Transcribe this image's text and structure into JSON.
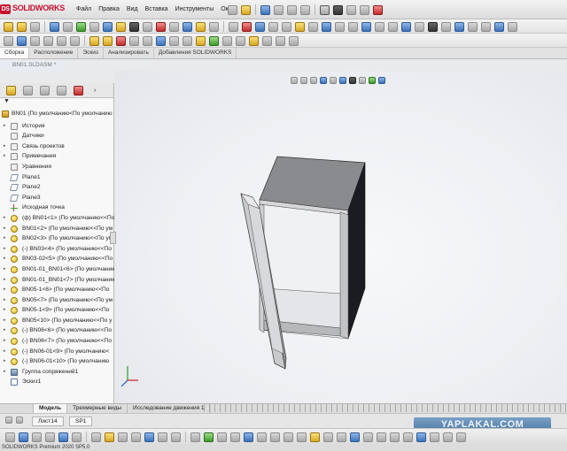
{
  "app": {
    "logo_text": "SOLIDWORKS",
    "logo_mark": "DS"
  },
  "menu": [
    "Файл",
    "Правка",
    "Вид",
    "Вставка",
    "Инструменты",
    "Окно"
  ],
  "command_tabs": [
    {
      "label": "Сборка",
      "active": true
    },
    {
      "label": "Расположение",
      "active": false
    },
    {
      "label": "Эскиз",
      "active": false
    },
    {
      "label": "Анализировать",
      "active": false
    },
    {
      "label": "Добавления SOLIDWORKS",
      "active": false
    }
  ],
  "document_tab": "BN01.SLDASM *",
  "feature_tree": {
    "filter_symbol": "▼",
    "root": "BN01  (По умолчанию<По умолчанию",
    "items": [
      {
        "label": "История",
        "icon": "folder-icon",
        "expandable": true
      },
      {
        "label": "Датчики",
        "icon": "folder-icon",
        "expandable": false
      },
      {
        "label": "Связь проектов",
        "icon": "folder-icon",
        "expandable": true
      },
      {
        "label": "Примечания",
        "icon": "folder-icon",
        "expandable": true
      },
      {
        "label": "Уравнения",
        "icon": "folder-icon",
        "expandable": false
      },
      {
        "label": "Plane1",
        "icon": "plane-icon",
        "expandable": false
      },
      {
        "label": "Plane2",
        "icon": "plane-icon",
        "expandable": false
      },
      {
        "label": "Plane3",
        "icon": "plane-icon",
        "expandable": false
      },
      {
        "label": "Исходная точка",
        "icon": "origin-icon",
        "expandable": false
      },
      {
        "label": "(ф) BN01<1> (По умолчанию<<По",
        "icon": "component-icon",
        "expandable": true
      },
      {
        "label": "BN01<2> (По умолчанию<<По ум",
        "icon": "component-icon",
        "expandable": true
      },
      {
        "label": "BN02<3> (По умолчанию<<По ум",
        "icon": "component-icon",
        "expandable": true
      },
      {
        "label": "(-) BN03<4> (По умолчанию<<По",
        "icon": "component-icon",
        "expandable": true
      },
      {
        "label": "BN03-02<5> (По умолчанию<<По",
        "icon": "component-icon",
        "expandable": true
      },
      {
        "label": "BN01-01_BN01<6> (По умолчанию",
        "icon": "component-icon",
        "expandable": true
      },
      {
        "label": "BN01-01_BN01<7> (По умолчанию",
        "icon": "component-icon",
        "expandable": true
      },
      {
        "label": "BN05-1<6> (По умолчанию<<По",
        "icon": "component-icon",
        "expandable": true
      },
      {
        "label": "BN05<7> (По умолчанию<<По ум",
        "icon": "component-icon",
        "expandable": true
      },
      {
        "label": "BN05-1<9> (По умолчанию<<По",
        "icon": "component-icon",
        "expandable": true
      },
      {
        "label": "BN05<10> (По умолчанию<<По у",
        "icon": "component-icon",
        "expandable": true
      },
      {
        "label": "(-) BN06<6> (По умолчанию<<По",
        "icon": "component-icon",
        "expandable": true
      },
      {
        "label": "(-) BN06<7> (По умолчанию<<По",
        "icon": "component-icon",
        "expandable": true
      },
      {
        "label": "(-) BN06-01<9> (По умолчанию<",
        "icon": "component-icon",
        "expandable": true
      },
      {
        "label": "(-) BN06-01<10> (По умолчанию",
        "icon": "component-icon",
        "expandable": true
      },
      {
        "label": "Группа сопряжений1",
        "icon": "mate-icon",
        "expandable": true
      },
      {
        "label": "Эскиз1",
        "icon": "sketch-icon",
        "expandable": false
      }
    ]
  },
  "bottom_tabs": [
    {
      "label": "Модель",
      "active": true
    },
    {
      "label": "Трехмерные виды",
      "active": false
    },
    {
      "label": "Исследование движения 1",
      "active": false
    }
  ],
  "sheet_tabs": [
    "Лист14",
    "SP1"
  ],
  "watermark": "YAPLAKAL.COM",
  "status_text": "SOLIDWORKS Premium 2020 SP5.0"
}
